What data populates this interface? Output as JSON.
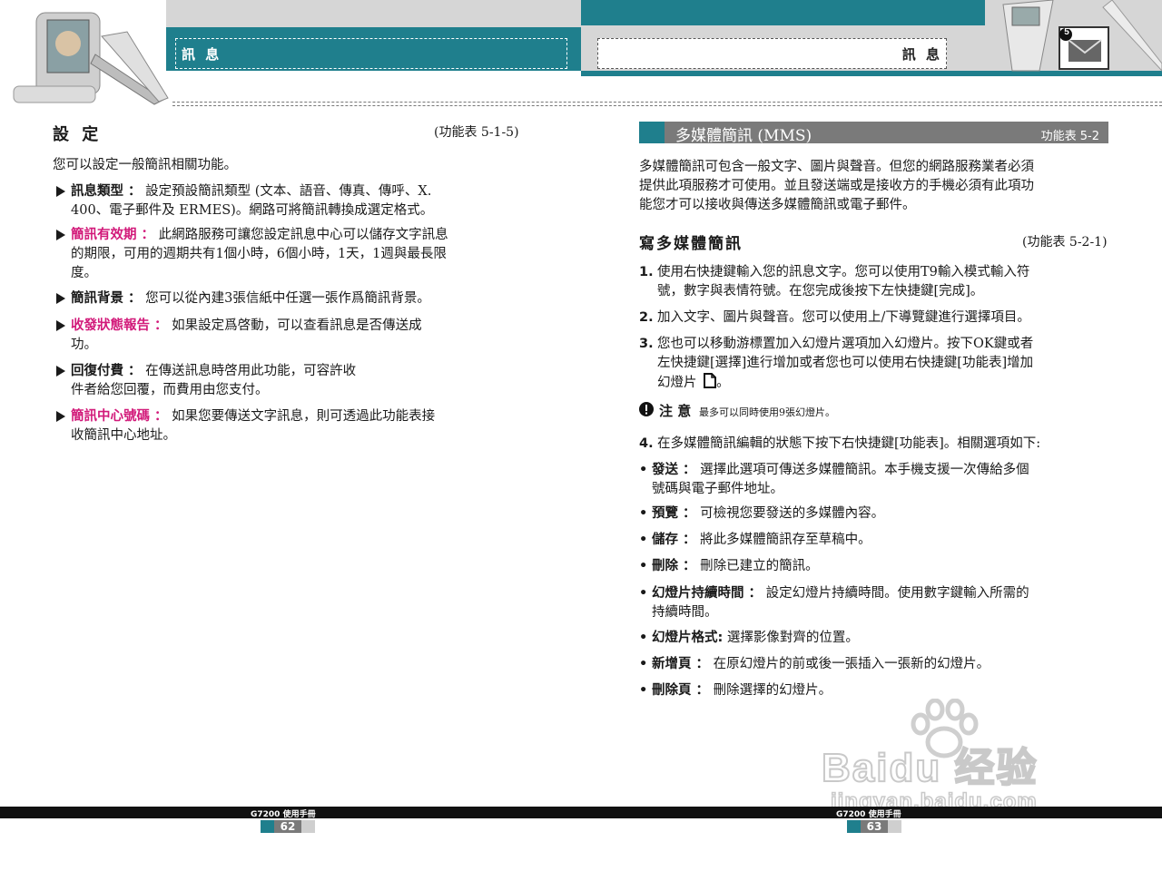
{
  "header": {
    "left_title": "訊 息",
    "right_title": "訊 息",
    "section_badge": "5"
  },
  "left": {
    "heading": "設 定",
    "heading_ref": "(功能表 5-1-5)",
    "intro": "您可以設定一般簡訊相關功能。",
    "items": [
      {
        "term": "訊息類型 ：",
        "l1": "設定預設簡訊類型 (文本、語音、傳真、傳呼、X.",
        "l2": "400、電子郵件及 ERMES)。網路可將簡訊轉換成選定格式。"
      },
      {
        "term": "簡訊有效期 ：",
        "l1": "此網路服務可讓您設定訊息中心可以儲存文字訊息",
        "l2": "的期限，可用的週期共有1個小時，6個小時，1天，1週與最長限",
        "l3": "度。"
      },
      {
        "term": "簡訊背景 ：",
        "l1": "您可以從內建3張信紙中任選一張作爲簡訊背景。"
      },
      {
        "term": "收發狀態報告 ：",
        "l1": "如果設定爲啓動，可以查看訊息是否傳送成",
        "l2": "功。"
      },
      {
        "term": "回復付費 ：",
        "l1": "在傳送訊息時啓用此功能，可容許收",
        "l2": "件者給您回覆，而費用由您支付。"
      },
      {
        "term": "簡訊中心號碼 ：",
        "l1": "如果您要傳送文字訊息，則可透過此功能表接",
        "l2": "收簡訊中心地址。"
      }
    ],
    "footer_model": "G7200 使用手冊",
    "page_number": "62"
  },
  "right": {
    "bar_title": "多媒體簡訊 (MMS)",
    "bar_ref": "功能表 5-2",
    "intro_l1": "多媒體簡訊可包含一般文字、圖片與聲音。但您的網路服務業者必須",
    "intro_l2": "提供此項服務才可使用。並且發送端或是接收方的手機必須有此項功",
    "intro_l3": "能您才可以接收與傳送多媒體簡訊或電子郵件。",
    "sub_heading": "寫多媒體簡訊",
    "sub_ref": "(功能表 5-2-1)",
    "steps": [
      {
        "num": "1.",
        "l1": "使用右快捷鍵輸入您的訊息文字。您可以使用T9輸入模式輸入符",
        "l2": "號，數字與表情符號。在您完成後按下左快捷鍵[完成]。"
      },
      {
        "num": "2.",
        "l1": "加入文字、圖片與聲音。您可以使用上/下導覽鍵進行選擇項目。"
      },
      {
        "num": "3.",
        "l1": "您也可以移動游標置加入幻燈片選項加入幻燈片。按下OK鍵或者",
        "l2": "左快捷鍵[選擇]進行增加或者您也可以使用右快捷鍵[功能表]增加",
        "l3": "幻燈片"
      }
    ],
    "note_label": "注 意",
    "note_text": "最多可以同時使用9張幻燈片。",
    "step4_num": "4.",
    "step4_text": "在多媒體簡訊編輯的狀態下按下右快捷鍵[功能表]。相關選項如下:",
    "bullets": [
      {
        "term": "發送 ：",
        "l1": "選擇此選項可傳送多媒體簡訊。本手機支援一次傳給多個",
        "l2": "號碼與電子郵件地址。"
      },
      {
        "term": "預覽 ：",
        "l1": "可檢視您要發送的多媒體內容。"
      },
      {
        "term": "儲存 ：",
        "l1": "將此多媒體簡訊存至草稿中。"
      },
      {
        "term": "刪除 ：",
        "l1": "刪除已建立的簡訊。"
      },
      {
        "term": "幻燈片持續時間 ：",
        "l1": "設定幻燈片持續時間。使用數字鍵輸入所需的",
        "l2": "持續時間。"
      },
      {
        "term": "幻燈片格式:",
        "l1": "選擇影像對齊的位置。"
      },
      {
        "term": "新增頁 ：",
        "l1": "在原幻燈片的前或後一張插入一張新的幻燈片。"
      },
      {
        "term": "刪除頁 ：",
        "l1": "刪除選擇的幻燈片。"
      }
    ],
    "footer_model": "G7200 使用手冊",
    "page_number": "63"
  },
  "watermark": {
    "logo": "Baidu 经验",
    "url": "jingyan.baidu.com"
  },
  "colors": {
    "teal": "#1f7f8d",
    "pink": "#d21a7a",
    "bar_gray": "#7a7a7a"
  }
}
